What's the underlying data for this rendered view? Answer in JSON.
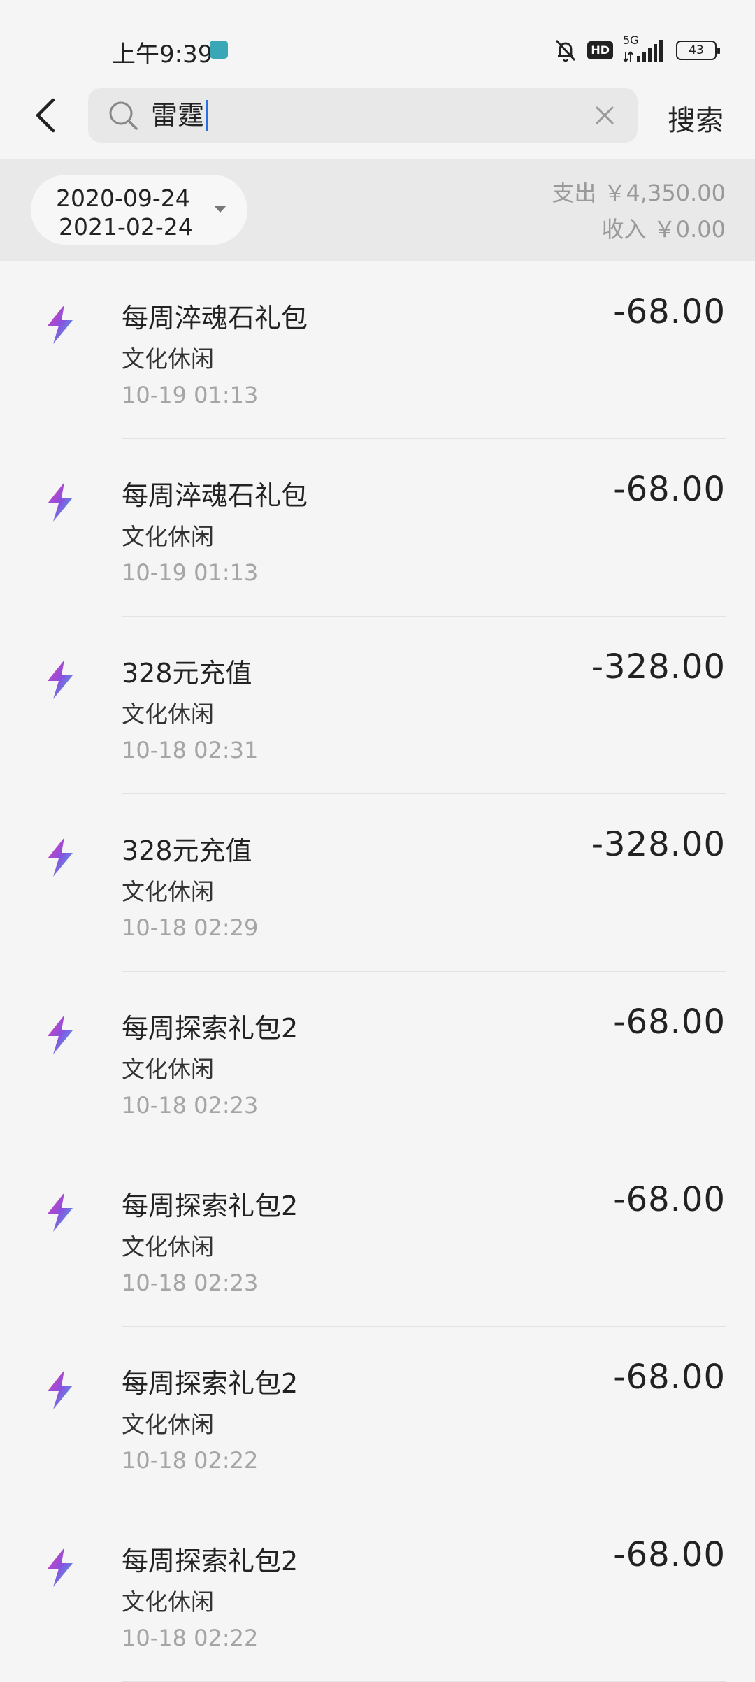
{
  "status_bar": {
    "time": "上午9:39",
    "hd": "HD",
    "network": "5G",
    "battery": "43"
  },
  "search": {
    "query": "雷霆",
    "button_label": "搜索"
  },
  "filter": {
    "date_start": "2020-09-24",
    "date_end": "2021-02-24",
    "expense": "支出 ￥4,350.00",
    "income": "收入 ￥0.00"
  },
  "transactions": [
    {
      "title": "每周淬魂石礼包",
      "category": "文化休闲",
      "time": "10-19  01:13",
      "amount": "-68.00"
    },
    {
      "title": "每周淬魂石礼包",
      "category": "文化休闲",
      "time": "10-19  01:13",
      "amount": "-68.00"
    },
    {
      "title": "328元充值",
      "category": "文化休闲",
      "time": "10-18  02:31",
      "amount": "-328.00"
    },
    {
      "title": "328元充值",
      "category": "文化休闲",
      "time": "10-18  02:29",
      "amount": "-328.00"
    },
    {
      "title": "每周探索礼包2",
      "category": "文化休闲",
      "time": "10-18  02:23",
      "amount": "-68.00"
    },
    {
      "title": "每周探索礼包2",
      "category": "文化休闲",
      "time": "10-18  02:23",
      "amount": "-68.00"
    },
    {
      "title": "每周探索礼包2",
      "category": "文化休闲",
      "time": "10-18  02:22",
      "amount": "-68.00"
    },
    {
      "title": "每周探索礼包2",
      "category": "文化休闲",
      "time": "10-18  02:22",
      "amount": "-68.00"
    }
  ]
}
